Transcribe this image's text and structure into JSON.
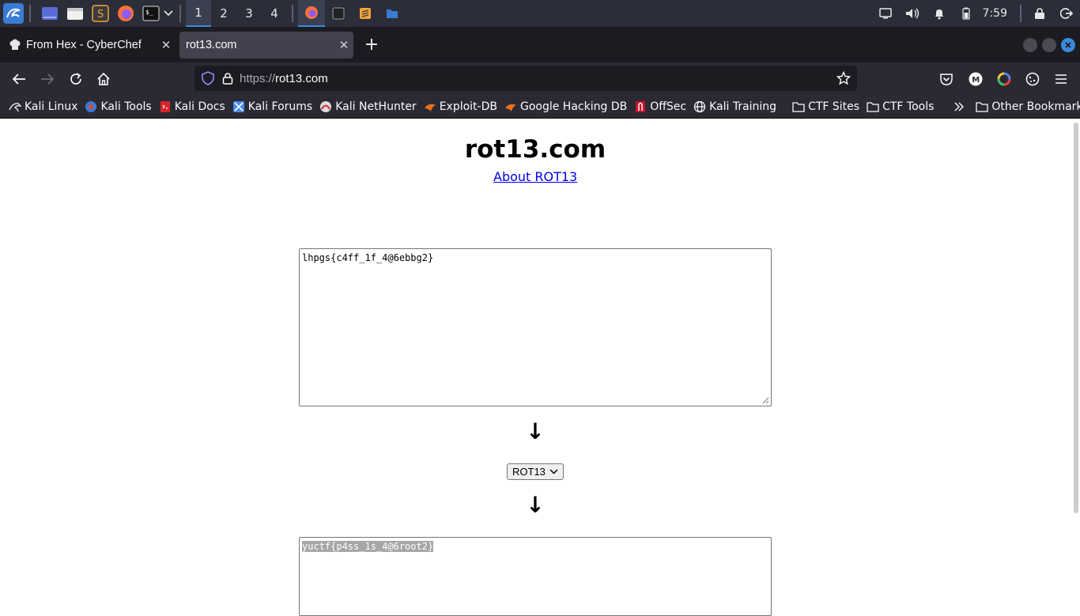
{
  "taskbar": {
    "workspaces": [
      "1",
      "2",
      "3",
      "4"
    ],
    "active_workspace": "1",
    "clock": "7:59"
  },
  "browser": {
    "tabs": [
      {
        "title": "From Hex - CyberChef",
        "active": false
      },
      {
        "title": "rot13.com",
        "active": true
      }
    ],
    "url_protocol": "https://",
    "url_host": "rot13.com",
    "bookmarks": [
      {
        "label": "Kali Linux",
        "icon": "kali-dragon-icon"
      },
      {
        "label": "Kali Tools",
        "icon": "kali-tools-icon"
      },
      {
        "label": "Kali Docs",
        "icon": "kali-docs-icon"
      },
      {
        "label": "Kali Forums",
        "icon": "kali-forums-icon"
      },
      {
        "label": "Kali NetHunter",
        "icon": "nethunter-icon"
      },
      {
        "label": "Exploit-DB",
        "icon": "exploit-db-icon"
      },
      {
        "label": "Google Hacking DB",
        "icon": "ghdb-icon"
      },
      {
        "label": "OffSec",
        "icon": "offsec-icon"
      },
      {
        "label": "Kali Training",
        "icon": "globe-icon"
      },
      {
        "label": "CTF Sites",
        "icon": "folder-icon"
      },
      {
        "label": "CTF Tools",
        "icon": "folder-icon"
      }
    ],
    "other_bookmarks": "Other Bookmarks"
  },
  "page": {
    "title": "rot13.com",
    "about_link": "About ROT13",
    "input_text": "lhpgs{c4ff_1f_4@6ebbg2}",
    "cipher_select": "ROT13",
    "output_text": "yuctf{p4ss_1s_4@6root2}"
  },
  "colors": {
    "accent": "#3a8ad8",
    "link": "#0000ee"
  }
}
